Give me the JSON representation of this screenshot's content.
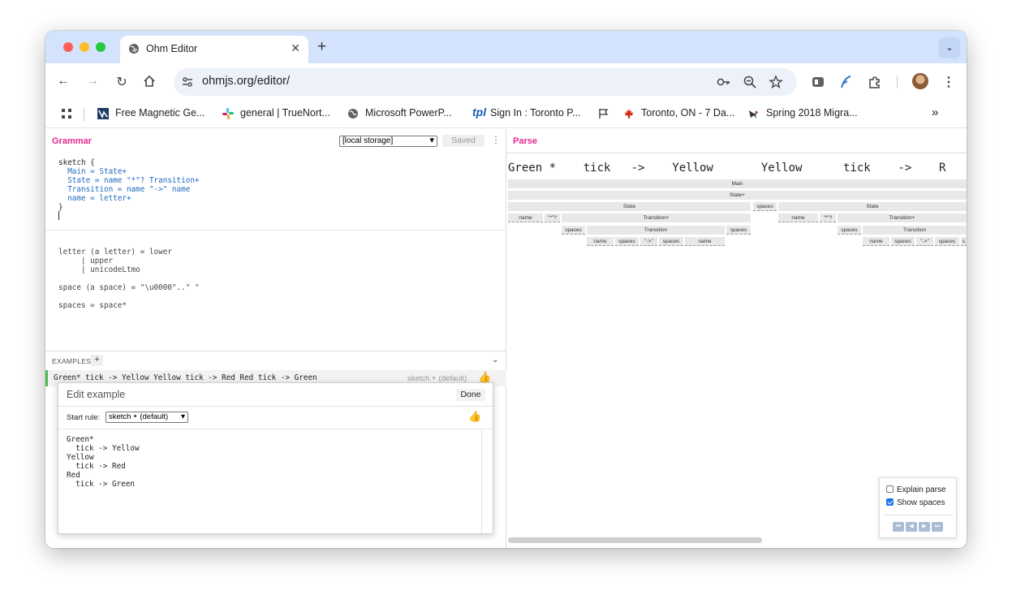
{
  "browser": {
    "tab": {
      "title": "Ohm Editor",
      "icon": "globe-icon"
    },
    "new_tab_label": "+",
    "url": "ohmjs.org/editor/",
    "bookmarks": [
      {
        "label": "Free Magnetic Ge...",
        "icon": "magnetic-icon"
      },
      {
        "label": "general | TrueNort...",
        "icon": "slack-icon"
      },
      {
        "label": "Microsoft PowerP...",
        "icon": "globe-icon"
      },
      {
        "label": "Sign In : Toronto P...",
        "icon": "tpl-icon",
        "icon_text": "tpl"
      },
      {
        "label": "",
        "icon": "flag-icon"
      },
      {
        "label": "Toronto, ON - 7 Da...",
        "icon": "maple-leaf-icon"
      },
      {
        "label": "Spring 2018 Migra...",
        "icon": "hummingbird-icon"
      }
    ],
    "bookmarks_overflow": "»"
  },
  "grammar_pane": {
    "title": "Grammar",
    "storage_select": "[local storage]",
    "saved_label": "Saved",
    "code_top": [
      "sketch {",
      "  Main = State+",
      "  State = name \"*\"? Transition+",
      "  Transition = name \"->\" name",
      "  name = letter+",
      "}"
    ],
    "code_bottom": [
      "letter (a letter) = lower",
      "     | upper",
      "     | unicodeLtmo",
      "",
      "space (a space) = \"\\u0000\"..\" \"",
      "",
      "spaces = space*"
    ]
  },
  "examples": {
    "header": "EXAMPLES",
    "add_label": "+",
    "items": [
      {
        "text": "Green* tick -> Yellow Yellow tick -> Red Red tick -> Green",
        "rule": "sketch ‣ (default)",
        "status_icon": "thumbs-up-icon"
      }
    ]
  },
  "edit_example": {
    "title": "Edit example",
    "done_label": "Done",
    "start_rule_label": "Start rule:",
    "start_rule_value": "sketch ‣ (default)",
    "status_icon": "thumbs-up-icon",
    "lines": [
      "Green*",
      "  tick -> Yellow",
      "Yellow",
      "  tick -> Red",
      "Red",
      "  tick -> Green"
    ]
  },
  "parse_pane": {
    "title": "Parse",
    "input_text": "Green *    tick   ->    Yellow       Yellow      tick    ->    R",
    "tree_rows": [
      [
        {
          "label": "Main"
        }
      ],
      [
        {
          "label": "State+"
        }
      ],
      [
        {
          "label": "State"
        },
        {
          "label": "spaces"
        },
        {
          "label": "State"
        }
      ],
      [
        {
          "label": "name"
        },
        {
          "label": "\"*\"?"
        },
        {
          "label": "Transition+"
        },
        {
          "label": "name"
        },
        {
          "label": "\"*\"?"
        },
        {
          "label": "Transition+"
        }
      ],
      [
        {
          "label": "spaces"
        },
        {
          "label": "Transition"
        },
        {
          "label": "spaces"
        },
        {
          "label": "spaces"
        },
        {
          "label": "Transition"
        }
      ],
      [
        {
          "label": "name"
        },
        {
          "label": "spaces"
        },
        {
          "label": "\"->\""
        },
        {
          "label": "spaces"
        },
        {
          "label": "name"
        },
        {
          "label": "name"
        },
        {
          "label": "spaces"
        },
        {
          "label": "\"->\""
        },
        {
          "label": "spaces"
        },
        {
          "label": "s"
        }
      ]
    ]
  },
  "options": {
    "explain_parse": {
      "label": "Explain parse",
      "checked": false
    },
    "show_spaces": {
      "label": "Show spaces",
      "checked": true
    },
    "playback_buttons": [
      "⏮",
      "◀",
      "▶",
      "⏭"
    ]
  }
}
